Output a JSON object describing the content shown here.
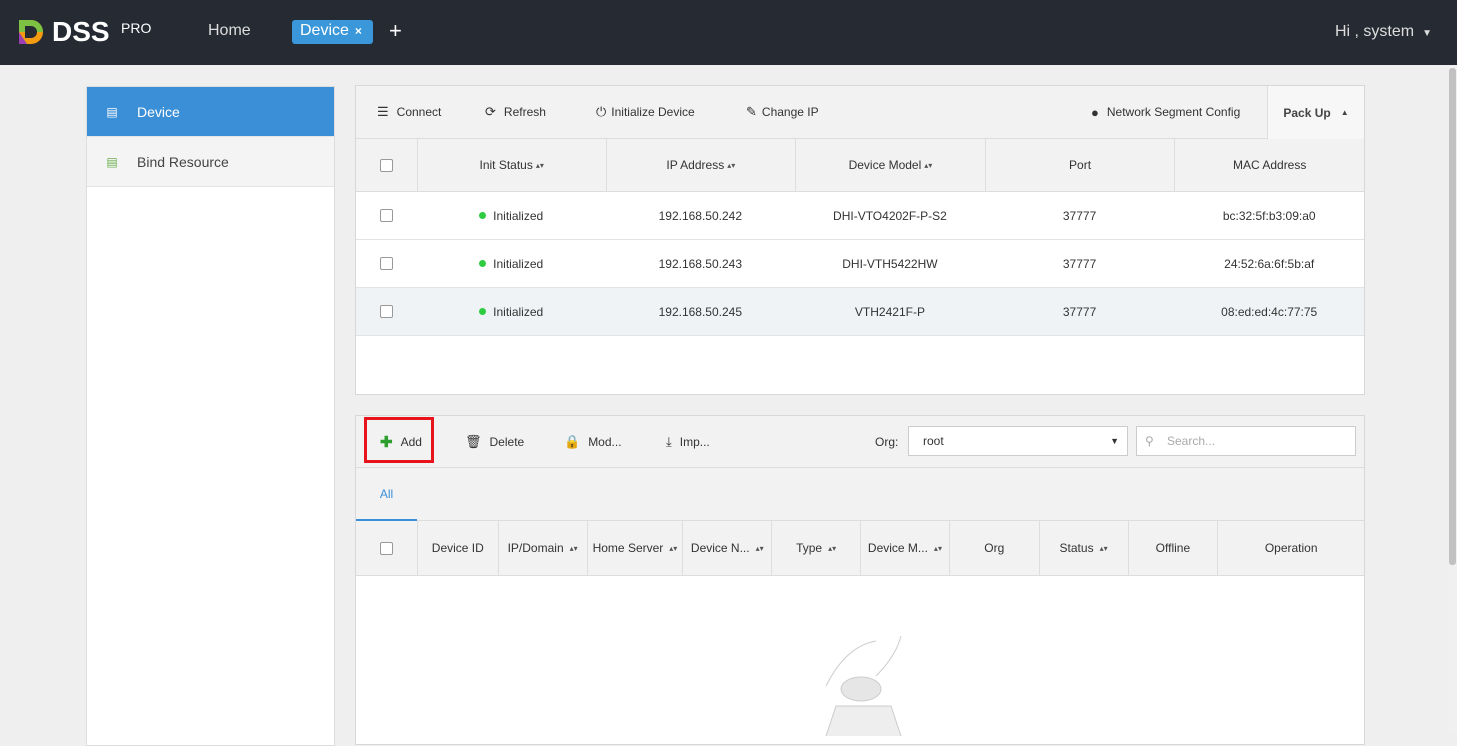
{
  "header": {
    "brand": "DSS",
    "brand_sup": "PRO",
    "home": "Home",
    "tab": "Device",
    "tab_close": "×",
    "add_tab": "+",
    "user": "Hi , system",
    "user_caret": "▼"
  },
  "sidebar": {
    "items": [
      {
        "label": "Device",
        "icon": "device-icon"
      },
      {
        "label": "Bind Resource",
        "icon": "server-icon"
      }
    ]
  },
  "online": {
    "toolbar": {
      "connect": "Connect",
      "refresh": "Refresh",
      "initialize": "Initialize Device",
      "change_ip": "Change IP",
      "network": "Network Segment Config",
      "pack_up": "Pack Up",
      "pack_caret": "▲"
    },
    "columns": [
      "Init Status",
      "IP Address",
      "Device Model",
      "Port",
      "MAC Address"
    ],
    "sortable": [
      "▴▾",
      "▴▾",
      "▴▾",
      "",
      ""
    ],
    "rows": [
      {
        "status": "Initialized",
        "ip": "192.168.50.242",
        "model": "DHI-VTO4202F-P-S2",
        "port": "37777",
        "mac": "bc:32:5f:b3:09:a0"
      },
      {
        "status": "Initialized",
        "ip": "192.168.50.243",
        "model": "DHI-VTH5422HW",
        "port": "37777",
        "mac": "24:52:6a:6f:5b:af"
      },
      {
        "status": "Initialized",
        "ip": "192.168.50.245",
        "model": "VTH2421F-P",
        "port": "37777",
        "mac": "08:ed:ed:4c:77:75"
      }
    ]
  },
  "managed": {
    "toolbar": {
      "add": "Add",
      "delete": "Delete",
      "modify": "Mod...",
      "import": "Imp...",
      "org_label": "Org:",
      "org_value": "root",
      "search_placeholder": "Search..."
    },
    "tabs": [
      "All"
    ],
    "columns": [
      "Device ID",
      "IP/Domain",
      "Home Server",
      "Device N...",
      "Type",
      "Device M...",
      "Org",
      "Status",
      "Offline",
      "Operation"
    ],
    "sortable": [
      false,
      true,
      true,
      true,
      true,
      true,
      false,
      true,
      false,
      false
    ]
  },
  "colors": {
    "topbar": "#252a33",
    "accent": "#3a8fd6",
    "highlight": "#e8141b",
    "online": "#2ecc40"
  }
}
